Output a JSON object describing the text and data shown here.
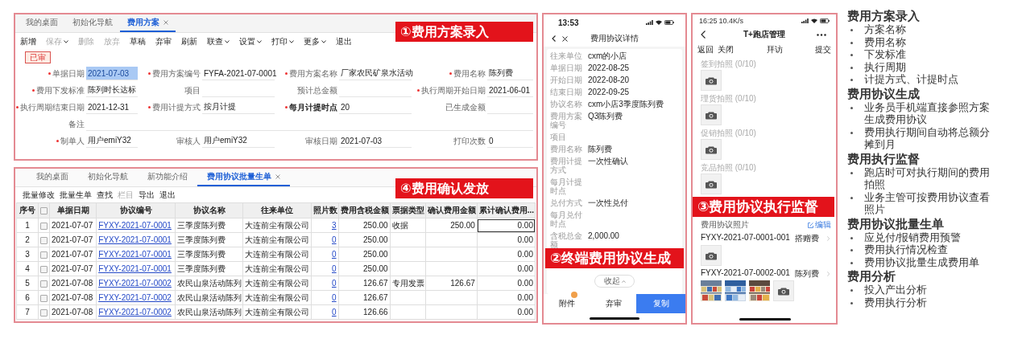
{
  "plan_panel": {
    "tabs": [
      {
        "label": "我的桌面",
        "selected": false,
        "closable": false
      },
      {
        "label": "初始化导航",
        "selected": false,
        "closable": false
      },
      {
        "label": "费用方案",
        "selected": true,
        "closable": true
      }
    ],
    "toolbar": [
      {
        "label": "新增",
        "disabled": false,
        "dropdown": false
      },
      {
        "label": "保存",
        "disabled": true,
        "dropdown": true
      },
      {
        "label": "删除",
        "disabled": true,
        "dropdown": false
      },
      {
        "label": "放弃",
        "disabled": true,
        "dropdown": false
      },
      {
        "label": "草稿",
        "disabled": false,
        "dropdown": false
      },
      {
        "label": "弃审",
        "disabled": false,
        "dropdown": false
      },
      {
        "label": "刷新",
        "disabled": false,
        "dropdown": false
      },
      {
        "label": "联查",
        "disabled": false,
        "dropdown": true
      },
      {
        "label": "设置",
        "disabled": false,
        "dropdown": true
      },
      {
        "label": "打印",
        "disabled": false,
        "dropdown": true
      },
      {
        "label": "更多",
        "disabled": false,
        "dropdown": true
      },
      {
        "label": "退出",
        "disabled": false,
        "dropdown": false
      }
    ],
    "status": "已审",
    "rows": [
      [
        {
          "label": "单据日期",
          "value": "2021-07-03",
          "required": true,
          "bold": false,
          "highlighted": true
        },
        {
          "label": "费用方案编号",
          "value": "FYFA-2021-07-0001",
          "required": true,
          "bold": false,
          "highlighted": false
        },
        {
          "label": "费用方案名称",
          "value": "厂家农民矿泉水活动",
          "required": true,
          "bold": false,
          "highlighted": false
        },
        {
          "label": "费用名称",
          "value": "陈列费",
          "required": true,
          "bold": false,
          "highlighted": false
        }
      ],
      [
        {
          "label": "费用下发标准",
          "value": "陈列时长达标",
          "required": true,
          "bold": false,
          "highlighted": false
        },
        {
          "label": "项目",
          "required": false,
          "bold": false,
          "highlighted": false
        },
        {
          "label": "预计总金额",
          "required": false,
          "bold": false,
          "highlighted": false
        },
        {
          "label": "执行周期开始日期",
          "value": "2021-06-01",
          "required": true,
          "bold": false,
          "highlighted": false
        }
      ],
      [
        {
          "label": "执行周期结束日期",
          "value": "2021-12-31",
          "required": true,
          "bold": false,
          "highlighted": false
        },
        {
          "label": "费用计提方式",
          "value": "按月计提",
          "required": true,
          "bold": false,
          "highlighted": false
        },
        {
          "label": "每月计提时点",
          "value": "20",
          "required": true,
          "bold": true,
          "highlighted": false
        },
        {
          "label": "已生成金额",
          "required": false,
          "bold": false,
          "highlighted": false
        }
      ],
      [
        {
          "label": "备注",
          "required": false,
          "bold": false,
          "highlighted": false
        }
      ],
      [
        {
          "label": "制单人",
          "value": "用户emiY32",
          "required": true,
          "bold": false,
          "highlighted": false
        },
        {
          "label": "审核人",
          "value": "用户emiY32",
          "required": false,
          "bold": false,
          "highlighted": false
        },
        {
          "label": "审核日期",
          "value": "2021-07-03",
          "required": false,
          "bold": false,
          "highlighted": false
        },
        {
          "label": "打印次数",
          "value": "0",
          "required": false,
          "bold": false,
          "highlighted": false
        }
      ]
    ],
    "banner": "①费用方案录入"
  },
  "batch_panel": {
    "tabs": [
      {
        "label": "我的桌面",
        "selected": false,
        "closable": false
      },
      {
        "label": "初始化导航",
        "selected": false,
        "closable": false
      },
      {
        "label": "新功能介绍",
        "selected": false,
        "closable": false
      },
      {
        "label": "费用协议批量生单",
        "selected": true,
        "closable": true
      }
    ],
    "toolbar": [
      {
        "label": "批量修改",
        "disabled": false
      },
      {
        "label": "批量生单",
        "disabled": false
      },
      {
        "label": "查找",
        "disabled": false
      },
      {
        "label": "栏目",
        "disabled": true
      },
      {
        "label": "导出",
        "disabled": false
      },
      {
        "label": "退出",
        "disabled": false
      }
    ],
    "columns": [
      {
        "label": "序号",
        "kind": "text"
      },
      {
        "kind": "checkbox",
        "checked": false
      },
      {
        "label": "单据日期",
        "kind": "text"
      },
      {
        "label": "协议编号",
        "kind": "link"
      },
      {
        "label": "协议名称",
        "kind": "text"
      },
      {
        "label": "往来单位",
        "kind": "text"
      },
      {
        "label": "照片数",
        "kind": "count_link"
      },
      {
        "label": "费用含税金额",
        "kind": "number"
      },
      {
        "label": "票据类型",
        "kind": "text"
      },
      {
        "label": "确认费用金额",
        "kind": "number"
      },
      {
        "label": "累计确认费用...",
        "kind": "number"
      }
    ],
    "rows": [
      {
        "no": "1",
        "checked": false,
        "focused": true,
        "date": "2021-07-07",
        "code": "FYXY-2021-07-0001",
        "name": "三季度陈列费",
        "unit": "大连前尘有限公司",
        "photos": "3",
        "amount": "250.00",
        "invoice_type": "收据",
        "confirmed": "250.00",
        "cumulative": "0.00"
      },
      {
        "no": "2",
        "checked": false,
        "focused": false,
        "date": "2021-07-07",
        "code": "FYXY-2021-07-0001",
        "name": "三季度陈列费",
        "unit": "大连前尘有限公司",
        "photos": "0",
        "amount": "250.00",
        "cumulative": "0.00"
      },
      {
        "no": "3",
        "checked": false,
        "focused": false,
        "date": "2021-07-07",
        "code": "FYXY-2021-07-0001",
        "name": "三季度陈列费",
        "unit": "大连前尘有限公司",
        "photos": "0",
        "amount": "250.00",
        "cumulative": "0.00"
      },
      {
        "no": "4",
        "checked": false,
        "focused": false,
        "date": "2021-07-07",
        "code": "FYXY-2021-07-0001",
        "name": "三季度陈列费",
        "unit": "大连前尘有限公司",
        "photos": "0",
        "amount": "250.00",
        "cumulative": "0.00"
      },
      {
        "no": "5",
        "checked": false,
        "focused": false,
        "date": "2021-07-08",
        "code": "FYXY-2021-07-0002",
        "name": "农民山泉活动陈列",
        "unit": "大连前尘有限公司",
        "photos": "0",
        "amount": "126.67",
        "invoice_type": "专用发票",
        "confirmed": "126.67",
        "cumulative": "0.00"
      },
      {
        "no": "6",
        "checked": false,
        "focused": false,
        "date": "2021-07-08",
        "code": "FYXY-2021-07-0002",
        "name": "农民山泉活动陈列",
        "unit": "大连前尘有限公司",
        "photos": "0",
        "amount": "126.67",
        "cumulative": "0.00"
      },
      {
        "no": "7",
        "checked": false,
        "focused": false,
        "date": "2021-07-08",
        "code": "FYXY-2021-07-0002",
        "name": "农民山泉活动陈列",
        "unit": "大连前尘有限公司",
        "photos": "0",
        "amount": "126.66",
        "cumulative": "0.00"
      }
    ],
    "banner": "④费用确认发放"
  },
  "detail_phone": {
    "time": "13:53",
    "title": "费用协议详情",
    "details": [
      {
        "label": "往来单位",
        "value": "cxm的小店"
      },
      {
        "label": "单据日期",
        "value": "2022-08-25"
      },
      {
        "label": "开始日期",
        "value": "2022-08-20"
      },
      {
        "label": "结束日期",
        "value": "2022-09-25"
      },
      {
        "label": "协议名称",
        "value": "cxm小店3季度陈列费"
      },
      {
        "label": "费用方案编号",
        "value": "Q3陈列费"
      },
      {
        "label": "项目"
      },
      {
        "label": "费用名称",
        "value": "陈列费"
      },
      {
        "label": "费用计提方式",
        "value": "一次性确认"
      },
      {
        "label": "每月计提时点"
      },
      {
        "label": "兑付方式",
        "value": "一次性兑付"
      },
      {
        "label": "每月兑付时点"
      },
      {
        "label": "含税总金额",
        "value": "2,000.00"
      }
    ],
    "collapse": "收起",
    "actions": [
      {
        "label": "附件",
        "kind": "plain",
        "badge": true
      },
      {
        "label": "弃审",
        "kind": "plain",
        "badge": false
      },
      {
        "label": "复制",
        "kind": "primary",
        "badge": false
      }
    ],
    "banner": "②终端费用协议生成"
  },
  "visit_phone": {
    "status_time": "16:25",
    "net_speed": "10.4K/s",
    "title": "T+跑店管理",
    "left_actions": [
      "返回",
      "关闭"
    ],
    "center_action": "拜访",
    "right_action": "提交",
    "photo_slots": [
      {
        "label": "签到拍照 (0/10)"
      },
      {
        "label": "理货拍照 (0/10)"
      },
      {
        "label": "促销拍照 (0/10)"
      },
      {
        "label": "竞品拍照 (0/10)"
      }
    ],
    "agreement_photos_title": "费用协议照片",
    "edit": "编辑",
    "agreements": [
      {
        "code": "FYXY-2021-07-0001-001",
        "name": "搭赠费",
        "photos": [
          {
            "kind": "camera"
          }
        ]
      },
      {
        "code": "FYXY-2021-07-0002-001",
        "name": "陈列费",
        "photos": [
          {
            "kind": "picture"
          },
          {
            "kind": "picture"
          },
          {
            "kind": "picture"
          },
          {
            "kind": "camera"
          }
        ]
      }
    ],
    "banner": "③费用协议执行监督"
  },
  "notes": [
    {
      "heading": "费用方案录入",
      "bullets": [
        "方案名称",
        "费用名称",
        "下发标准",
        "执行周期",
        "计提方式、计提时点"
      ]
    },
    {
      "heading": "费用协议生成",
      "bullets": [
        "业务员手机端直接参照方案生成费用协议",
        "费用执行期间自动将总额分摊到月"
      ]
    },
    {
      "heading": "费用执行监督",
      "bullets": [
        "跑店时可对执行期间的费用拍照",
        "业务主管可按费用协议查看照片"
      ]
    },
    {
      "heading": "费用协议批量生单",
      "bullets": [
        "应兑付/报销费用预警",
        "费用执行情况检查",
        "费用协议批量生成费用单"
      ]
    },
    {
      "heading": "费用分析",
      "bullets": [
        "投入产出分析",
        "费用执行分析"
      ]
    }
  ]
}
